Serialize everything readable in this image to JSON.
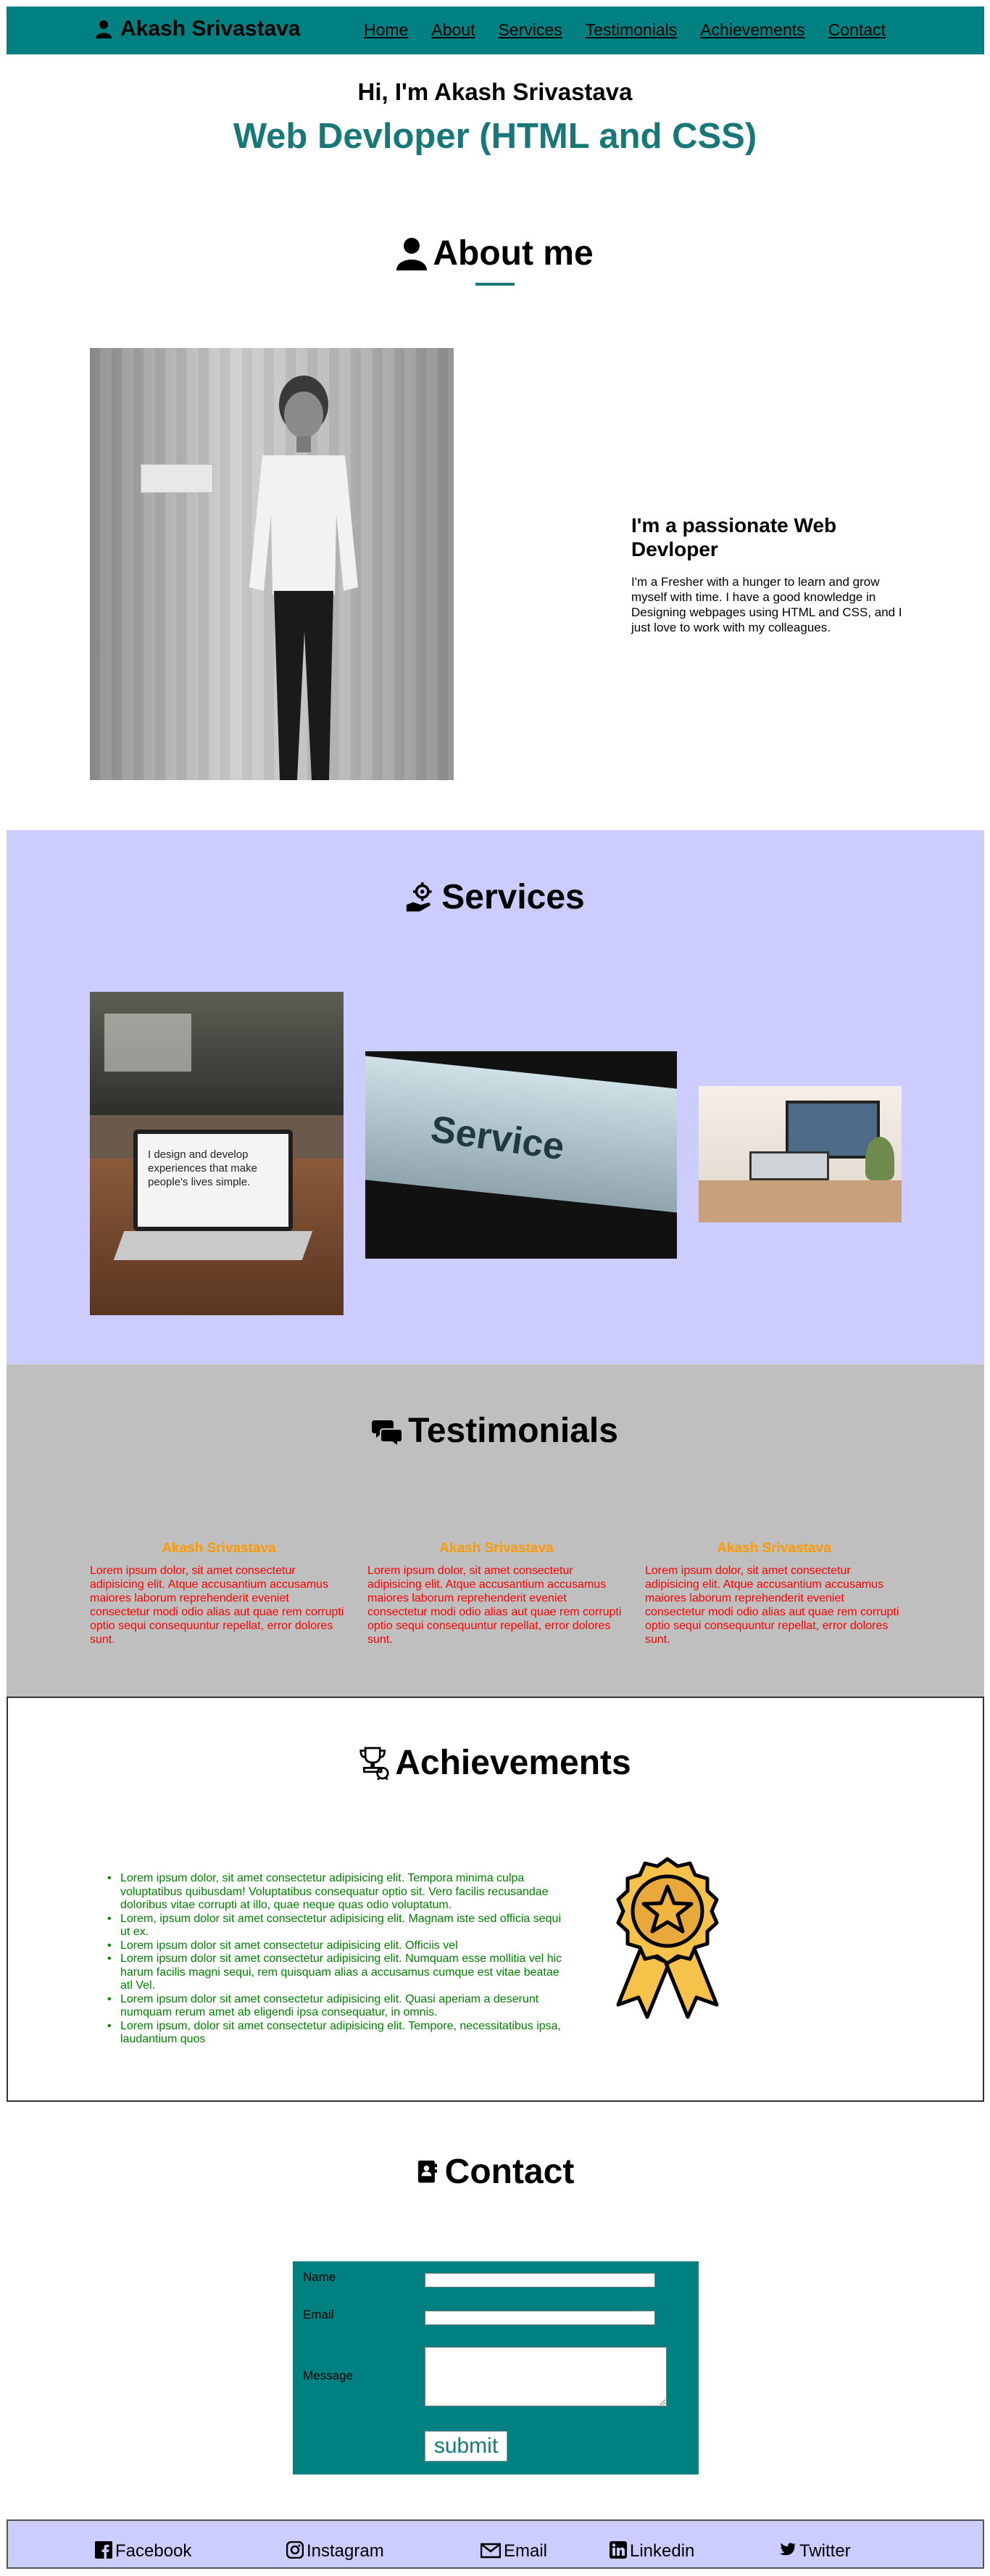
{
  "brand": {
    "name": "Akash Srivastava",
    "icon": "user-icon"
  },
  "nav": [
    {
      "label": "Home"
    },
    {
      "label": "About"
    },
    {
      "label": "Services"
    },
    {
      "label": "Testimonials"
    },
    {
      "label": "Achievements"
    },
    {
      "label": "Contact"
    }
  ],
  "hero": {
    "greeting": "Hi, I'm Akash Srivastava",
    "role": "Web Devloper (HTML and CSS)"
  },
  "about": {
    "heading": "About me",
    "icon": "user-icon",
    "title": "I'm a passionate Web Devloper",
    "text": "I'm a Fresher with a hunger to learn and grow myself with time. I have a good knowledge in Designing webpages using HTML and CSS, and I just love to work with my colleagues."
  },
  "services": {
    "heading": "Services",
    "icon": "hand-gear-icon",
    "sign_text": "Service",
    "laptop_text": "I design and develop experiences that make people's lives simple."
  },
  "testimonials": {
    "heading": "Testimonials",
    "icon": "chat-bubbles-icon",
    "items": [
      {
        "name": "Akash Srivastava",
        "text": "Lorem ipsum dolor, sit amet consectetur adipisicing elit. Atque accusantium accusamus maiores laborum reprehenderit eveniet consectetur modi odio alias aut quae rem corrupti optio sequi consequuntur repellat, error dolores sunt."
      },
      {
        "name": "Akash Srivastava",
        "text": "Lorem ipsum dolor, sit amet consectetur adipisicing elit. Atque accusantium accusamus maiores laborum reprehenderit eveniet consectetur modi odio alias aut quae rem corrupti optio sequi consequuntur repellat, error dolores sunt."
      },
      {
        "name": "Akash Srivastava",
        "text": "Lorem ipsum dolor, sit amet consectetur adipisicing elit. Atque accusantium accusamus maiores laborum reprehenderit eveniet consectetur modi odio alias aut quae rem corrupti optio sequi consequuntur repellat, error dolores sunt."
      }
    ]
  },
  "achievements": {
    "heading": "Achievements",
    "icon": "trophy-icon",
    "items": [
      "Lorem ipsum dolor, sit amet consectetur adipisicing elit. Tempora minima culpa voluptatibus quibusdam! Voluptatibus consequatur optio sit. Vero facilis recusandae doloribus vitae corrupti at illo, quae neque quas odio voluptatum.",
      "Lorem, ipsum dolor sit amet consectetur adipisicing elit. Magnam iste sed officia sequi ut ex.",
      "Lorem ipsum dolor sit amet consectetur adipisicing elit. Officiis vel",
      "Lorem ipsum dolor sit amet consectetur adipisicing elit. Numquam esse mollitia vel hic harum facilis magni sequi, rem quisquam alias a accusamus cumque est vitae beatae atl Vel.",
      "Lorem ipsum dolor sit amet consectetur adipisicing elit. Quasi aperiam a deserunt numquam rerum amet ab eligendi ipsa consequatur, in omnis.",
      "Lorem ipsum, dolor sit amet consectetur adipisicing elit. Tempore, necessitatibus ipsa, laudantium quos"
    ]
  },
  "contact": {
    "heading": "Contact",
    "icon": "contact-book-icon",
    "name_label": "Name",
    "email_label": "Email",
    "message_label": "Message",
    "submit_label": "submit"
  },
  "footer": [
    {
      "label": "Facebook",
      "icon": "facebook-icon"
    },
    {
      "label": "Instagram",
      "icon": "instagram-icon"
    },
    {
      "label": "Email",
      "icon": "envelope-icon"
    },
    {
      "label": "Linkedin",
      "icon": "linkedin-icon"
    },
    {
      "label": "Twitter",
      "icon": "twitter-icon"
    }
  ],
  "colors": {
    "teal": "#008080",
    "heading_teal": "#187878",
    "lavender": "#ccccff",
    "grey": "#bfbfbf",
    "orange": "#ff9900",
    "red": "#ff0000",
    "green": "#008000"
  }
}
